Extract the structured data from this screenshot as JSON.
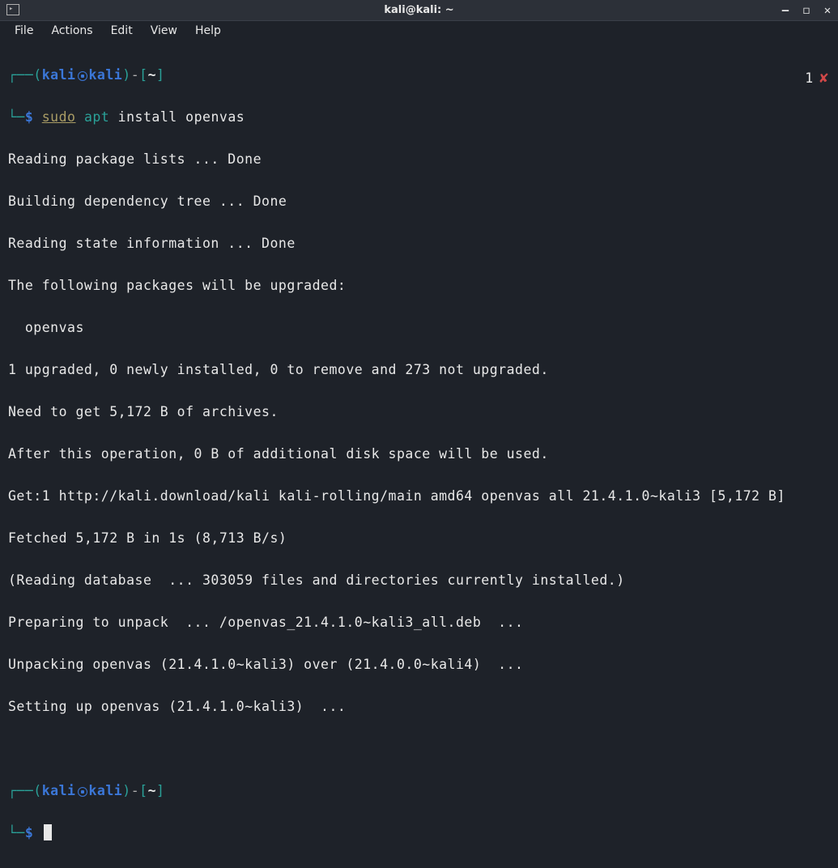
{
  "window": {
    "title": "kali@kali: ~"
  },
  "menubar": {
    "file": "File",
    "actions": "Actions",
    "edit": "Edit",
    "view": "View",
    "help": "Help"
  },
  "prompt": {
    "top_open": "┌──(",
    "user": "kali",
    "host": "kali",
    "top_close_dash": ")-[",
    "path": "~",
    "top_end": "]",
    "bottom_corner": "└─",
    "dollar": "$"
  },
  "command": {
    "sudo": "sudo",
    "apt": "apt",
    "rest": " install openvas"
  },
  "status": {
    "count": "1",
    "mark": "✘"
  },
  "output_lines": [
    "Reading package lists ... Done",
    "Building dependency tree ... Done",
    "Reading state information ... Done",
    "The following packages will be upgraded:",
    "  openvas",
    "1 upgraded, 0 newly installed, 0 to remove and 273 not upgraded.",
    "Need to get 5,172 B of archives.",
    "After this operation, 0 B of additional disk space will be used.",
    "Get:1 http://kali.download/kali kali-rolling/main amd64 openvas all 21.4.1.0~kali3 [5,172 B]",
    "Fetched 5,172 B in 1s (8,713 B/s)",
    "(Reading database  ... 303059 files and directories currently installed.)",
    "Preparing to unpack  ... /openvas_21.4.1.0~kali3_all.deb  ...",
    "Unpacking openvas (21.4.1.0~kali3) over (21.4.0.0~kali4)  ...",
    "Setting up openvas (21.4.1.0~kali3)  ..."
  ]
}
